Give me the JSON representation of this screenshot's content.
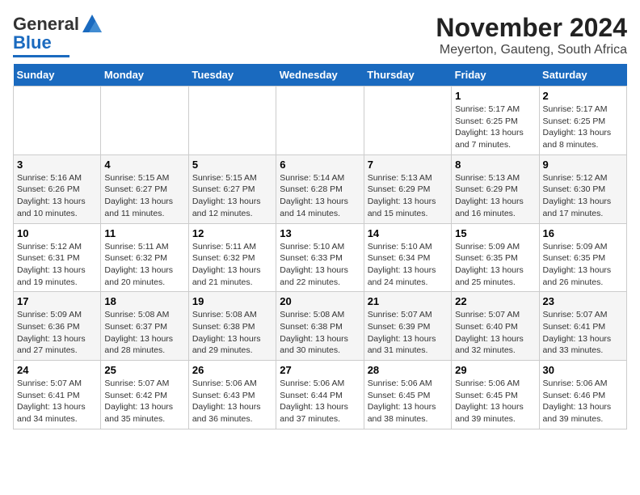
{
  "header": {
    "title": "November 2024",
    "subtitle": "Meyerton, Gauteng, South Africa",
    "logo_general": "General",
    "logo_blue": "Blue"
  },
  "weekdays": [
    "Sunday",
    "Monday",
    "Tuesday",
    "Wednesday",
    "Thursday",
    "Friday",
    "Saturday"
  ],
  "weeks": [
    [
      {
        "day": "",
        "info": ""
      },
      {
        "day": "",
        "info": ""
      },
      {
        "day": "",
        "info": ""
      },
      {
        "day": "",
        "info": ""
      },
      {
        "day": "",
        "info": ""
      },
      {
        "day": "1",
        "info": "Sunrise: 5:17 AM\nSunset: 6:25 PM\nDaylight: 13 hours\nand 7 minutes."
      },
      {
        "day": "2",
        "info": "Sunrise: 5:17 AM\nSunset: 6:25 PM\nDaylight: 13 hours\nand 8 minutes."
      }
    ],
    [
      {
        "day": "3",
        "info": "Sunrise: 5:16 AM\nSunset: 6:26 PM\nDaylight: 13 hours\nand 10 minutes."
      },
      {
        "day": "4",
        "info": "Sunrise: 5:15 AM\nSunset: 6:27 PM\nDaylight: 13 hours\nand 11 minutes."
      },
      {
        "day": "5",
        "info": "Sunrise: 5:15 AM\nSunset: 6:27 PM\nDaylight: 13 hours\nand 12 minutes."
      },
      {
        "day": "6",
        "info": "Sunrise: 5:14 AM\nSunset: 6:28 PM\nDaylight: 13 hours\nand 14 minutes."
      },
      {
        "day": "7",
        "info": "Sunrise: 5:13 AM\nSunset: 6:29 PM\nDaylight: 13 hours\nand 15 minutes."
      },
      {
        "day": "8",
        "info": "Sunrise: 5:13 AM\nSunset: 6:29 PM\nDaylight: 13 hours\nand 16 minutes."
      },
      {
        "day": "9",
        "info": "Sunrise: 5:12 AM\nSunset: 6:30 PM\nDaylight: 13 hours\nand 17 minutes."
      }
    ],
    [
      {
        "day": "10",
        "info": "Sunrise: 5:12 AM\nSunset: 6:31 PM\nDaylight: 13 hours\nand 19 minutes."
      },
      {
        "day": "11",
        "info": "Sunrise: 5:11 AM\nSunset: 6:32 PM\nDaylight: 13 hours\nand 20 minutes."
      },
      {
        "day": "12",
        "info": "Sunrise: 5:11 AM\nSunset: 6:32 PM\nDaylight: 13 hours\nand 21 minutes."
      },
      {
        "day": "13",
        "info": "Sunrise: 5:10 AM\nSunset: 6:33 PM\nDaylight: 13 hours\nand 22 minutes."
      },
      {
        "day": "14",
        "info": "Sunrise: 5:10 AM\nSunset: 6:34 PM\nDaylight: 13 hours\nand 24 minutes."
      },
      {
        "day": "15",
        "info": "Sunrise: 5:09 AM\nSunset: 6:35 PM\nDaylight: 13 hours\nand 25 minutes."
      },
      {
        "day": "16",
        "info": "Sunrise: 5:09 AM\nSunset: 6:35 PM\nDaylight: 13 hours\nand 26 minutes."
      }
    ],
    [
      {
        "day": "17",
        "info": "Sunrise: 5:09 AM\nSunset: 6:36 PM\nDaylight: 13 hours\nand 27 minutes."
      },
      {
        "day": "18",
        "info": "Sunrise: 5:08 AM\nSunset: 6:37 PM\nDaylight: 13 hours\nand 28 minutes."
      },
      {
        "day": "19",
        "info": "Sunrise: 5:08 AM\nSunset: 6:38 PM\nDaylight: 13 hours\nand 29 minutes."
      },
      {
        "day": "20",
        "info": "Sunrise: 5:08 AM\nSunset: 6:38 PM\nDaylight: 13 hours\nand 30 minutes."
      },
      {
        "day": "21",
        "info": "Sunrise: 5:07 AM\nSunset: 6:39 PM\nDaylight: 13 hours\nand 31 minutes."
      },
      {
        "day": "22",
        "info": "Sunrise: 5:07 AM\nSunset: 6:40 PM\nDaylight: 13 hours\nand 32 minutes."
      },
      {
        "day": "23",
        "info": "Sunrise: 5:07 AM\nSunset: 6:41 PM\nDaylight: 13 hours\nand 33 minutes."
      }
    ],
    [
      {
        "day": "24",
        "info": "Sunrise: 5:07 AM\nSunset: 6:41 PM\nDaylight: 13 hours\nand 34 minutes."
      },
      {
        "day": "25",
        "info": "Sunrise: 5:07 AM\nSunset: 6:42 PM\nDaylight: 13 hours\nand 35 minutes."
      },
      {
        "day": "26",
        "info": "Sunrise: 5:06 AM\nSunset: 6:43 PM\nDaylight: 13 hours\nand 36 minutes."
      },
      {
        "day": "27",
        "info": "Sunrise: 5:06 AM\nSunset: 6:44 PM\nDaylight: 13 hours\nand 37 minutes."
      },
      {
        "day": "28",
        "info": "Sunrise: 5:06 AM\nSunset: 6:45 PM\nDaylight: 13 hours\nand 38 minutes."
      },
      {
        "day": "29",
        "info": "Sunrise: 5:06 AM\nSunset: 6:45 PM\nDaylight: 13 hours\nand 39 minutes."
      },
      {
        "day": "30",
        "info": "Sunrise: 5:06 AM\nSunset: 6:46 PM\nDaylight: 13 hours\nand 39 minutes."
      }
    ]
  ]
}
